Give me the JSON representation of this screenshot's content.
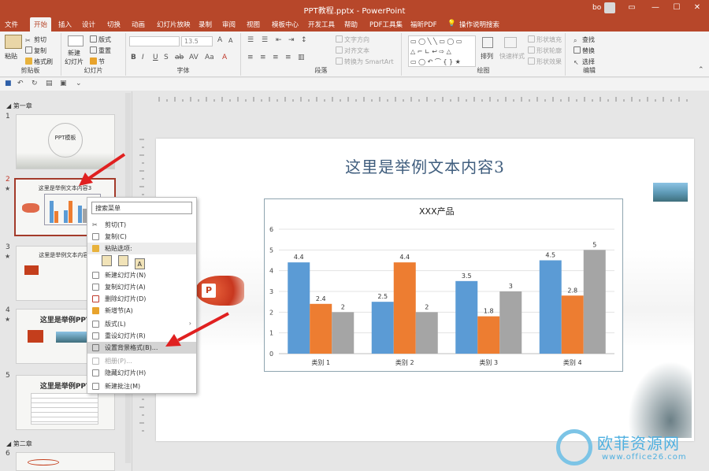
{
  "window": {
    "title": "PPT教程.pptx  -  PowerPoint",
    "user": "bo",
    "controls": [
      "▭",
      "—",
      "☐",
      "✕"
    ]
  },
  "tabs": [
    "文件",
    "开始",
    "插入",
    "设计",
    "切换",
    "动画",
    "幻灯片放映",
    "录制",
    "审阅",
    "视图",
    "模板中心",
    "开发工具",
    "帮助",
    "PDF工具集",
    "福昕PDF",
    "操作说明搜索"
  ],
  "ribbon": {
    "clipboard": {
      "paste": "粘贴",
      "cut": "剪切",
      "copy": "复制",
      "format_painter": "格式刷",
      "label": "剪贴板"
    },
    "slides": {
      "new_slide_1": "新建",
      "new_slide_2": "幻灯片",
      "layout": "版式",
      "reset": "重置",
      "section": "节",
      "label": "幻灯片"
    },
    "font": {
      "size": "13.5",
      "label": "字体"
    },
    "paragraph": {
      "text_direction": "文字方向",
      "align_text": "对齐文本",
      "smartart": "转换为 SmartArt",
      "label": "段落"
    },
    "drawing": {
      "arrange": "排列",
      "quick_styles": "快速样式",
      "fill": "形状填充",
      "outline": "形状轮廓",
      "effects": "形状效果",
      "label": "绘图"
    },
    "editing": {
      "find": "查找",
      "replace": "替换",
      "select": "选择",
      "label": "编辑"
    }
  },
  "panel": {
    "section1": "第一章",
    "section2": "第二章",
    "slides": [
      {
        "num": "1",
        "title": "PPT模板"
      },
      {
        "num": "2",
        "title": "这里是举例文本内容3"
      },
      {
        "num": "3",
        "title": "这里是举例文本内容1"
      },
      {
        "num": "4",
        "title": "这里是举例PPT"
      },
      {
        "num": "5",
        "title": "这里是举例PPT"
      },
      {
        "num": "6",
        "title": ""
      }
    ]
  },
  "slide": {
    "title": "这里是举例文本内容3"
  },
  "context_menu": {
    "search": "搜索菜单",
    "items": [
      {
        "label": "剪切(T)",
        "icon": "scissors-icon"
      },
      {
        "label": "复制(C)",
        "icon": "copy-icon"
      },
      {
        "label": "粘贴选项:",
        "icon": "paste-icon"
      },
      {
        "label": "新建幻灯片(N)",
        "icon": "new-slide-icon"
      },
      {
        "label": "复制幻灯片(A)",
        "icon": "duplicate-slide-icon"
      },
      {
        "label": "删除幻灯片(D)",
        "icon": "delete-slide-icon"
      },
      {
        "label": "新增节(A)",
        "icon": "add-section-icon"
      },
      {
        "label": "版式(L)",
        "icon": "layout-icon"
      },
      {
        "label": "重设幻灯片(R)",
        "icon": "reset-slide-icon"
      },
      {
        "label": "设置背景格式(B)...",
        "icon": "background-format-icon"
      },
      {
        "label": "相册(P)...",
        "icon": "photo-album-icon"
      },
      {
        "label": "隐藏幻灯片(H)",
        "icon": "hide-slide-icon"
      },
      {
        "label": "新建批注(M)",
        "icon": "new-comment-icon"
      }
    ]
  },
  "watermark": {
    "cn": "欧菲资源网",
    "url": "www.office26.com"
  },
  "colors": {
    "accent": "#b7472a",
    "series1": "#5b9bd5",
    "series2": "#ed7d31",
    "series3": "#a5a5a5"
  },
  "chart_data": {
    "type": "bar",
    "title": "XXX产品",
    "categories": [
      "类别 1",
      "类别 2",
      "类别 3",
      "类别 4"
    ],
    "series": [
      {
        "values": [
          4.4,
          2.5,
          3.5,
          4.5
        ]
      },
      {
        "values": [
          2.4,
          4.4,
          1.8,
          2.8
        ]
      },
      {
        "values": [
          2,
          2,
          3,
          5
        ]
      }
    ],
    "ylim": [
      0,
      6
    ],
    "yticks": [
      0,
      1,
      2,
      3,
      4,
      5,
      6
    ],
    "grid": true,
    "xlabel": "",
    "ylabel": ""
  }
}
